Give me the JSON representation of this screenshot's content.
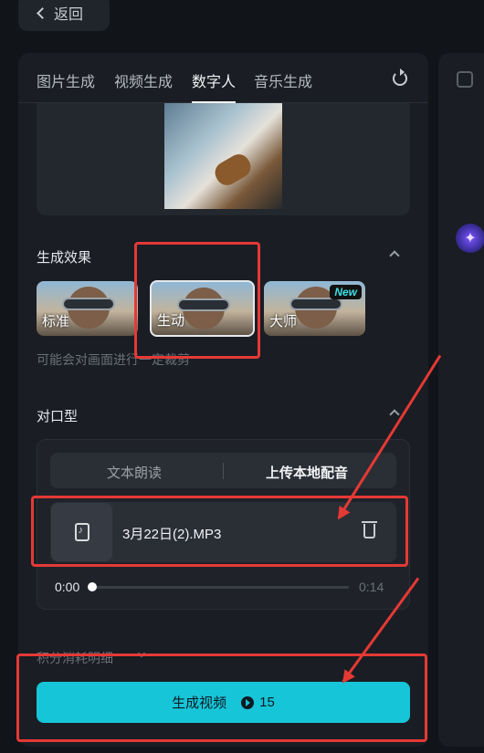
{
  "header": {
    "back_label": "返回"
  },
  "tabs": [
    {
      "label": "图片生成",
      "active": false
    },
    {
      "label": "视频生成",
      "active": false
    },
    {
      "label": "数字人",
      "active": true
    },
    {
      "label": "音乐生成",
      "active": false
    }
  ],
  "effect_section": {
    "title": "生成效果",
    "options": [
      {
        "label": "标准",
        "selected": false,
        "badge": ""
      },
      {
        "label": "生动",
        "selected": true,
        "badge": ""
      },
      {
        "label": "大师",
        "selected": false,
        "badge": "New"
      }
    ],
    "hint": "可能会对画面进行一定裁剪"
  },
  "lip_section": {
    "title": "对口型",
    "segments": [
      {
        "label": "文本朗读",
        "active": false
      },
      {
        "label": "上传本地配音",
        "active": true
      }
    ],
    "file": {
      "name": "3月22日(2).MP3"
    },
    "player": {
      "current": "0:00",
      "total": "0:14",
      "progress": 0
    }
  },
  "cost_detail_label": "积分消耗明细",
  "generate": {
    "label": "生成视频",
    "cost": "15"
  },
  "colors": {
    "accent": "#17c5d8",
    "annotation": "#e53935"
  }
}
